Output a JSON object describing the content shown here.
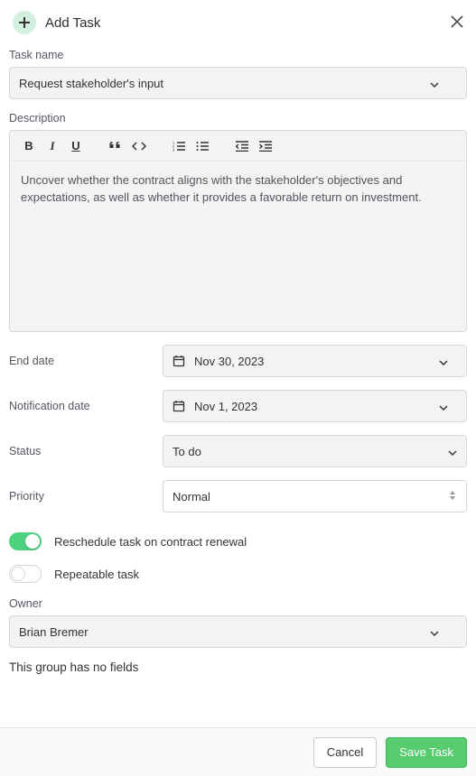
{
  "header": {
    "title": "Add Task"
  },
  "form": {
    "taskNameLabel": "Task name",
    "taskNameValue": "Request stakeholder's input",
    "descLabel": "Description",
    "descValue": "Uncover whether the contract aligns with the stakeholder's objectives and expectations, as well as whether it provides a favorable return on investment.",
    "endDateLabel": "End date",
    "endDateValue": "Nov 30, 2023",
    "notifLabel": "Notification date",
    "notifValue": "Nov 1, 2023",
    "statusLabel": "Status",
    "statusValue": "To do",
    "priorityLabel": "Priority",
    "priorityValue": "Normal",
    "rescheduleLabel": "Reschedule task on contract renewal",
    "repeatableLabel": "Repeatable task",
    "ownerLabel": "Owner",
    "ownerValue": "Brian Bremer",
    "noFieldsMsg": "This group has no fields"
  },
  "footer": {
    "cancel": "Cancel",
    "save": "Save Task"
  }
}
